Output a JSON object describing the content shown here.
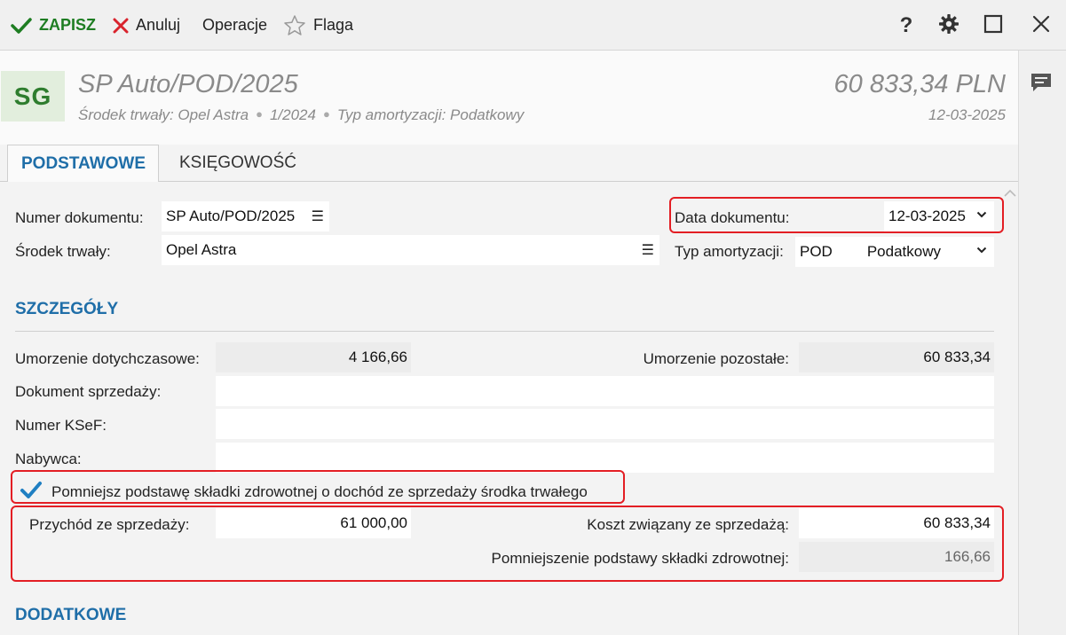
{
  "toolbar": {
    "save_label": "ZAPISZ",
    "cancel_label": "Anuluj",
    "operations_label": "Operacje",
    "flag_label": "Flaga",
    "help_label": "?"
  },
  "header": {
    "initials": "SG",
    "title": "SP Auto/POD/2025",
    "sub_asset": "Środek trwały: Opel Astra",
    "sub_number": "1/2024",
    "sub_type": "Typ amortyzacji: Podatkowy",
    "amount": "60 833,34 PLN",
    "date": "12-03-2025"
  },
  "tabs": [
    {
      "label": "PODSTAWOWE",
      "active": true
    },
    {
      "label": "KSIĘGOWOŚĆ",
      "active": false
    }
  ],
  "form": {
    "doc_number_label": "Numer dokumentu:",
    "doc_number_value": "SP Auto/POD/2025",
    "asset_label": "Środek trwały:",
    "asset_value": "Opel Astra",
    "doc_date_label": "Data dokumentu:",
    "doc_date_value": "12-03-2025",
    "amort_type_label": "Typ amortyzacji:",
    "amort_type_code": "POD",
    "amort_type_name": "Podatkowy"
  },
  "details": {
    "section_title": "SZCZEGÓŁY",
    "depreciation_so_far_label": "Umorzenie dotychczasowe:",
    "depreciation_so_far_value": "4 166,66",
    "depreciation_remaining_label": "Umorzenie pozostałe:",
    "depreciation_remaining_value": "60 833,34",
    "sale_document_label": "Dokument sprzedaży:",
    "sale_document_value": "",
    "ksef_label": "Numer KSeF:",
    "ksef_value": "",
    "buyer_label": "Nabywca:",
    "buyer_value": "",
    "reduce_checkbox_label": "Pomniejsz podstawę składki zdrowotnej o dochód ze sprzedaży środka trwałego",
    "reduce_checkbox_checked": true,
    "sale_revenue_label": "Przychód ze sprzedaży:",
    "sale_revenue_value": "61 000,00",
    "sale_cost_label": "Koszt związany ze sprzedażą:",
    "sale_cost_value": "60 833,34",
    "health_base_reduction_label": "Pomniejszenie podstawy składki zdrowotnej:",
    "health_base_reduction_value": "166,66"
  },
  "additional": {
    "section_title": "DODATKOWE"
  },
  "colors": {
    "accent_green": "#1e7d22",
    "accent_blue": "#1f6ea8",
    "cancel_red": "#d9232d",
    "highlight_red": "#e31e24"
  },
  "icons": {
    "save": "check-icon",
    "cancel": "x-icon",
    "flag": "star-icon",
    "help": "question-icon",
    "settings": "gear-icon",
    "maximize": "maximize-icon",
    "close": "close-icon",
    "comments": "comment-icon"
  }
}
